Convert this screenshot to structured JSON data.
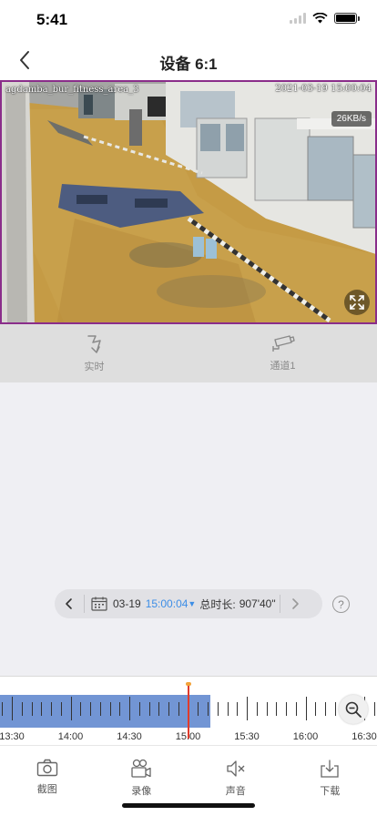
{
  "status_bar": {
    "time": "5:41"
  },
  "nav": {
    "title": "设备 6:1",
    "back_icon": "chevron-left-icon"
  },
  "video": {
    "camera_name": "agdamba_bur_fitness_area_3",
    "timestamp": "2021-03-19 15:00:04",
    "bitrate": "26KB/s",
    "border_color": "#8a2d8a"
  },
  "controls": [
    {
      "label": "实时",
      "icon": "live-icon"
    },
    {
      "label": "通道1",
      "icon": "camera-icon"
    }
  ],
  "playback": {
    "date": "03-19",
    "time": "15:00:04",
    "duration_label": "总时长:",
    "duration_value": "907'40\"",
    "help": "?"
  },
  "timeline": {
    "labels": [
      "13:30",
      "14:00",
      "14:30",
      "15:00",
      "15:30",
      "16:00",
      "16:30"
    ],
    "recorded_color": "#7295d4",
    "cursor_color": "#e03b2c"
  },
  "toolbar": [
    {
      "label": "截图",
      "icon": "screenshot-camera-icon"
    },
    {
      "label": "录像",
      "icon": "record-video-icon"
    },
    {
      "label": "声音",
      "icon": "speaker-mute-icon"
    },
    {
      "label": "下载",
      "icon": "download-icon"
    }
  ]
}
